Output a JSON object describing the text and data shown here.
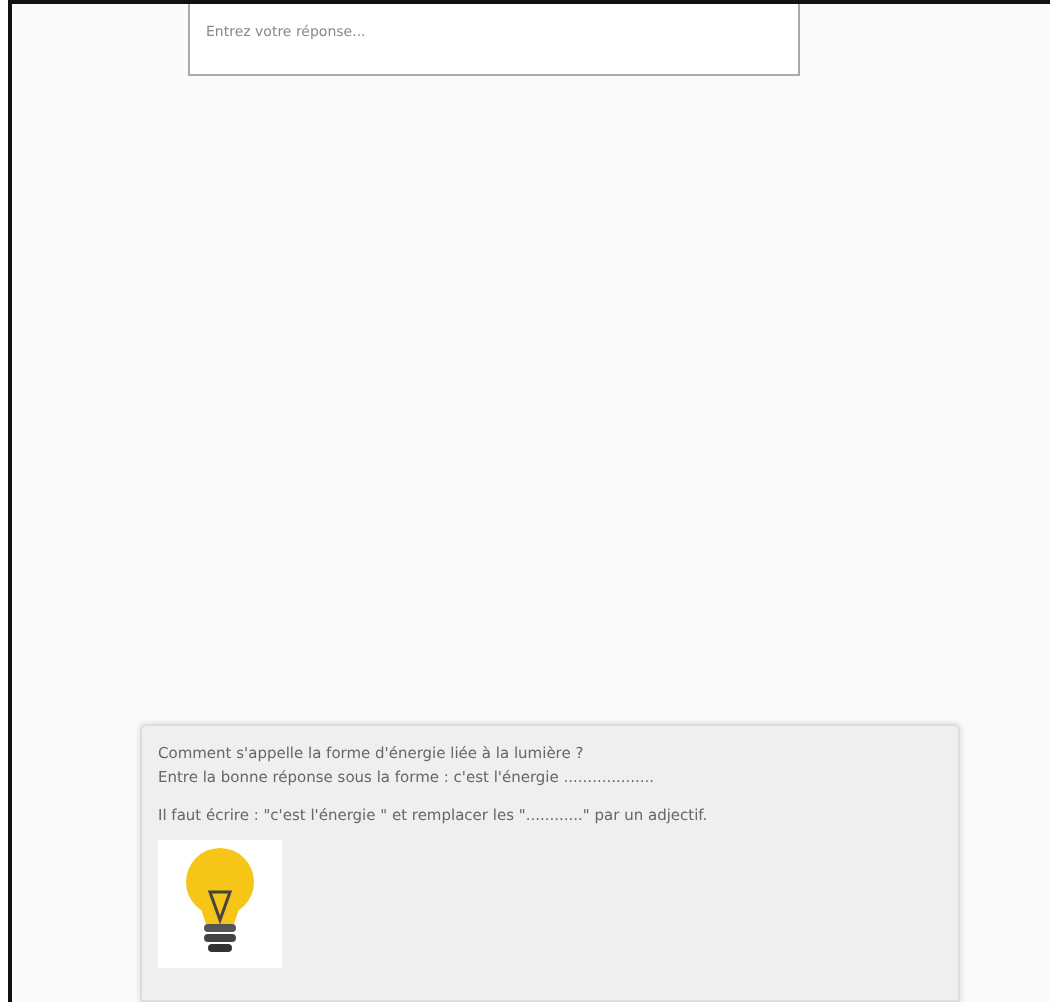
{
  "answer": {
    "placeholder": "Entrez votre réponse..."
  },
  "hint": {
    "lines": [
      "Comment s'appelle la forme d'énergie liée à la lumière ?",
      "Entre la bonne réponse sous la forme : c'est l'énergie ...................",
      "Il faut écrire : \"c'est l'énergie \" et remplacer les \"............\"   par un adjectif."
    ]
  }
}
